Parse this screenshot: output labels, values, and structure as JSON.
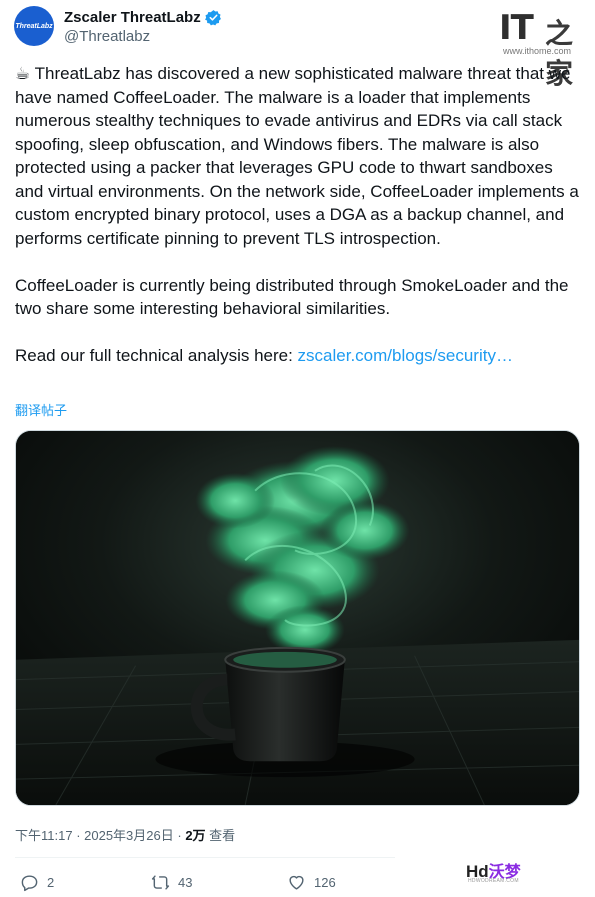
{
  "author": {
    "display_name": "Zscaler ThreatLabz",
    "handle": "@Threatlabz",
    "avatar_text": "ThreatLabz"
  },
  "watermark_top": {
    "brand": "IT",
    "cn": "之家",
    "url": "www.ithome.com"
  },
  "tweet": {
    "paragraph_1": "☕ ThreatLabz has discovered a new sophisticated malware threat that we have named CoffeeLoader. The malware is a loader that implements numerous stealthy techniques to evade antivirus and EDRs via call stack spoofing, sleep obfuscation, and Windows fibers. The malware is also protected using a packer that leverages GPU code to thwart sandboxes and virtual environments. On the network side, CoffeeLoader implements a custom encrypted binary protocol, uses a DGA as a backup channel, and performs certificate pinning to prevent TLS introspection.",
    "paragraph_2": "CoffeeLoader is currently being distributed through SmokeLoader and the two share some interesting behavioral similarities.",
    "paragraph_3_prefix": "Read our full technical analysis here: ",
    "link_text": "zscaler.com/blogs/security…",
    "translate_label": "翻译帖子"
  },
  "meta": {
    "time": "下午11:17",
    "separator": " · ",
    "date": "2025年3月26日",
    "views_count": "2万",
    "views_label": " 查看"
  },
  "actions": {
    "reply_count": "2",
    "retweet_count": "43",
    "like_count": "126"
  },
  "watermark_bottom": {
    "hd": "Hd",
    "cn": "沃梦",
    "sub": "HDWODREAM.COM"
  },
  "colors": {
    "link": "#1d9bf0",
    "secondary": "#536471",
    "avatar": "#1a5fd0",
    "smoke": "#3fbf83"
  }
}
